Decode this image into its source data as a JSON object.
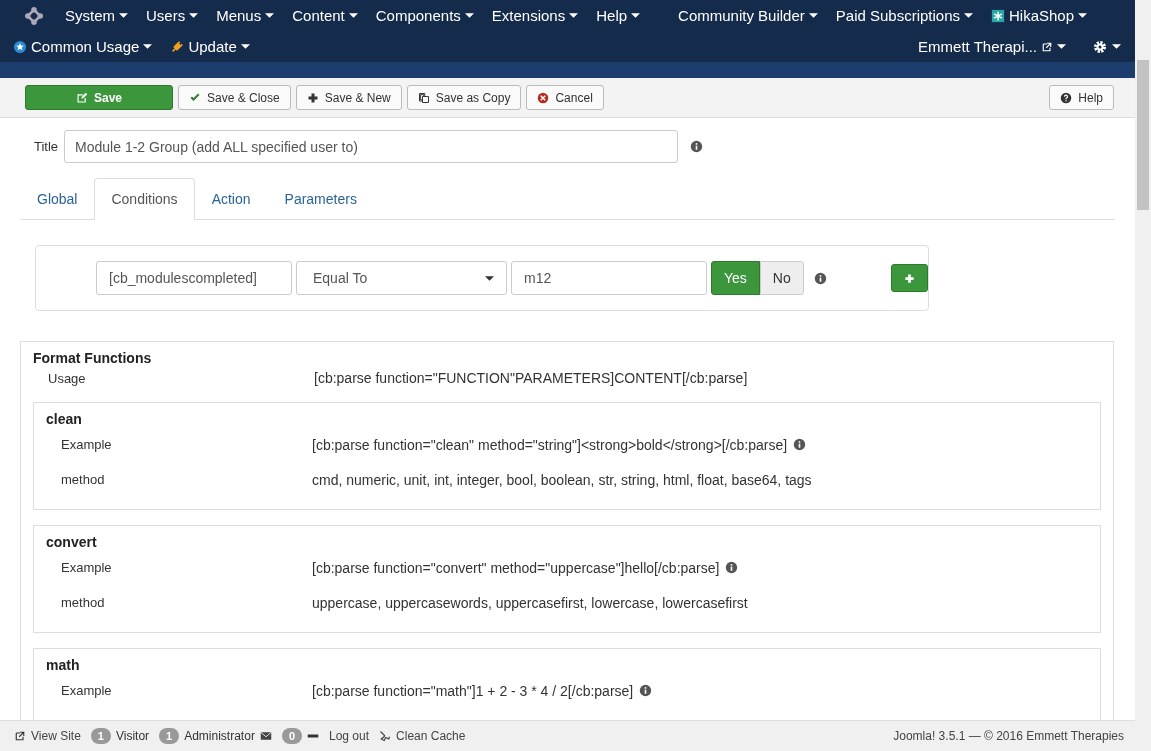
{
  "menu": {
    "row1": [
      {
        "label": "System",
        "dropdown": true
      },
      {
        "label": "Users",
        "dropdown": true
      },
      {
        "label": "Menus",
        "dropdown": true
      },
      {
        "label": "Content",
        "dropdown": true
      },
      {
        "label": "Components",
        "dropdown": true
      },
      {
        "label": "Extensions",
        "dropdown": true
      },
      {
        "label": "Help",
        "dropdown": true
      },
      {
        "label": "Community Builder",
        "dropdown": true
      },
      {
        "label": "Paid Subscriptions",
        "dropdown": true
      },
      {
        "label": "HikaShop",
        "dropdown": true
      }
    ],
    "row2": [
      {
        "label": "Common Usage",
        "dropdown": true
      },
      {
        "label": "Update",
        "dropdown": true
      }
    ],
    "site": {
      "label": "Emmett Therapi...",
      "dropdown": true
    }
  },
  "toolbar": [
    {
      "label": "Save",
      "kind": "primary"
    },
    {
      "label": "Save & Close",
      "kind": "default"
    },
    {
      "label": "Save & New",
      "kind": "default"
    },
    {
      "label": "Save as Copy",
      "kind": "default"
    },
    {
      "label": "Cancel",
      "kind": "default"
    }
  ],
  "help_button": {
    "label": "Help"
  },
  "title_field": {
    "label": "Title",
    "value": "Module 1-2 Group (add ALL specified user to)"
  },
  "tabs": [
    {
      "label": "Global",
      "selected": false
    },
    {
      "label": "Conditions",
      "selected": true
    },
    {
      "label": "Action",
      "selected": false
    },
    {
      "label": "Parameters",
      "selected": false
    }
  ],
  "condition": {
    "field": "[cb_modulescompleted]",
    "operator": "Equal To",
    "value": "m12",
    "toggle": [
      {
        "label": "Yes",
        "selected": true
      },
      {
        "label": "No",
        "selected": false
      }
    ]
  },
  "format_functions": {
    "title": "Format Functions",
    "usage_label": "Usage",
    "usage_value": "[cb:parse function=\"FUNCTION\"PARAMETERS]CONTENT[/cb:parse]",
    "sections": [
      {
        "name": "clean",
        "rows": [
          {
            "label": "Example",
            "value": "[cb:parse function=\"clean\" method=\"string\"]<strong>bold</strong>[/cb:parse]",
            "info": true
          },
          {
            "label": "method",
            "value": "cmd, numeric, unit, int, integer, bool, boolean, str, string, html, float, base64, tags",
            "info": false
          }
        ]
      },
      {
        "name": "convert",
        "rows": [
          {
            "label": "Example",
            "value": "[cb:parse function=\"convert\" method=\"uppercase\"]hello[/cb:parse]",
            "info": true
          },
          {
            "label": "method",
            "value": "uppercase, uppercasewords, uppercasefirst, lowercase, lowercasefirst",
            "info": false
          }
        ]
      },
      {
        "name": "math",
        "rows": [
          {
            "label": "Example",
            "value": "[cb:parse function=\"math\"]1 + 2 - 3 * 4 / 2[/cb:parse]",
            "info": true
          }
        ]
      }
    ]
  },
  "status_bar": {
    "items": [
      {
        "kind": "link",
        "label": "View Site"
      },
      {
        "kind": "count",
        "count": "1",
        "label": "Visitor"
      },
      {
        "kind": "count",
        "count": "1",
        "label": "Administrator"
      },
      {
        "kind": "count",
        "count": "0"
      },
      {
        "kind": "link",
        "label": "Log out"
      },
      {
        "kind": "link",
        "label": "Clean Cache"
      }
    ],
    "copyright": "Joomla! 3.5.1  —  © 2016 Emmett Therapies"
  }
}
